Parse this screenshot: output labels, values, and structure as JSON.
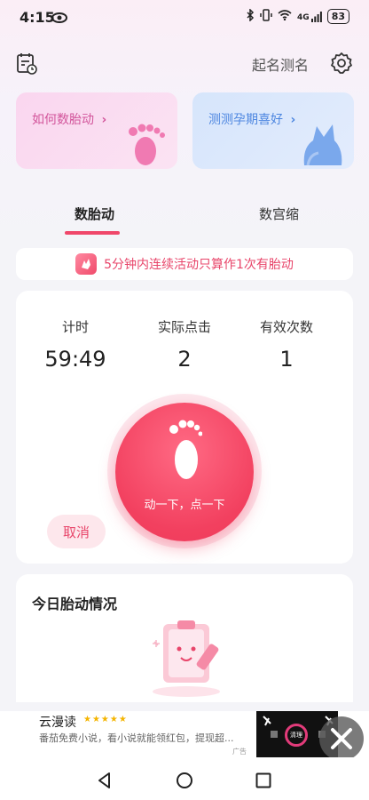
{
  "status_bar": {
    "time": "4:15",
    "network": "4G",
    "battery": "83"
  },
  "header": {
    "naming_link": "起名测名"
  },
  "promo_cards": [
    {
      "label": "如何数胎动",
      "chevron": "›"
    },
    {
      "label": "测测孕期喜好",
      "chevron": "›"
    }
  ],
  "tabs": [
    {
      "label": "数胎动",
      "active": true
    },
    {
      "label": "数宫缩",
      "active": false
    }
  ],
  "tip": {
    "text": "5分钟内连续活动只算作1次有胎动"
  },
  "counter": {
    "stats": [
      {
        "label": "计时",
        "value": "59:49"
      },
      {
        "label": "实际点击",
        "value": "2"
      },
      {
        "label": "有效次数",
        "value": "1"
      }
    ],
    "tap_label": "动一下，点一下",
    "cancel_label": "取消"
  },
  "today": {
    "title": "今日胎动情况"
  },
  "ad": {
    "title": "云漫读",
    "stars": "★★★★★",
    "description": "番茄免费小说，看小说就能领红包，提现超...",
    "tag": "广告",
    "thumb_label": "清理"
  },
  "colors": {
    "accent": "#f0476a",
    "pink_card": "#fad6ef",
    "blue_card": "#d6e5fb"
  }
}
